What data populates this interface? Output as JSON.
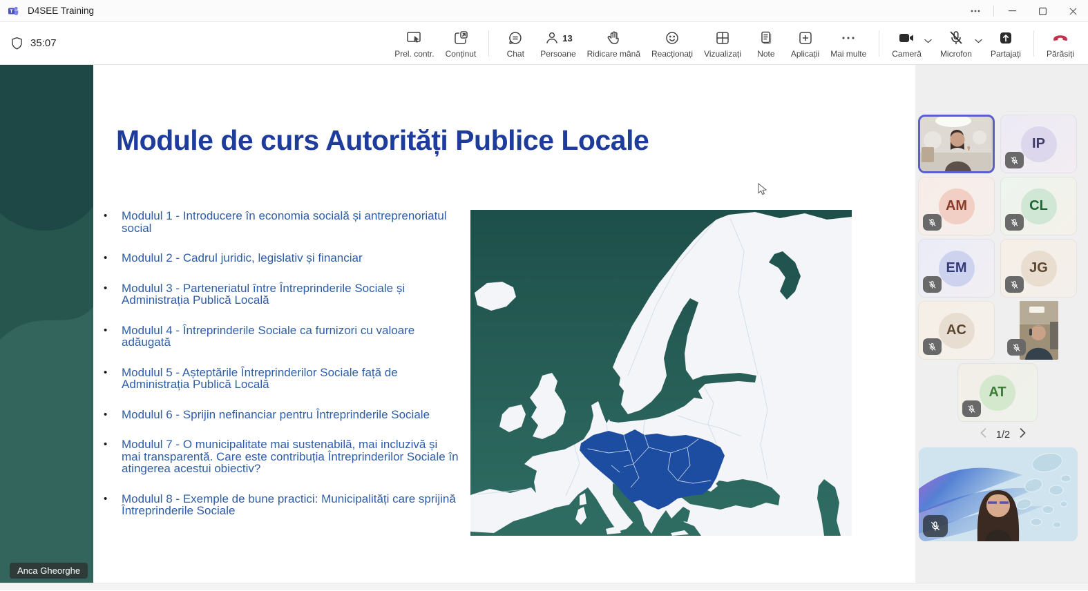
{
  "window": {
    "title": "D4SEE Training"
  },
  "meeting": {
    "timer": "35:07"
  },
  "toolbar": {
    "items": [
      {
        "id": "prel-contr",
        "label": "Prel. contr."
      },
      {
        "id": "continut",
        "label": "Conținut"
      },
      {
        "id": "chat",
        "label": "Chat"
      },
      {
        "id": "persoane",
        "label": "Persoane",
        "count": "13"
      },
      {
        "id": "ridicare-mana",
        "label": "Ridicare mână"
      },
      {
        "id": "reactionati",
        "label": "Reacționați"
      },
      {
        "id": "vizualizati",
        "label": "Vizualizați"
      },
      {
        "id": "note",
        "label": "Note"
      },
      {
        "id": "aplicatii",
        "label": "Aplicații"
      },
      {
        "id": "mai-multe",
        "label": "Mai multe"
      },
      {
        "id": "camera",
        "label": "Cameră"
      },
      {
        "id": "microfon",
        "label": "Microfon"
      },
      {
        "id": "partajati",
        "label": "Partajați"
      },
      {
        "id": "parasiti",
        "label": "Părăsiți"
      }
    ]
  },
  "slide": {
    "title": "Module de curs Autorități Publice Locale",
    "bullets": [
      "Modulul 1 - Introducere în economia socială și antreprenoriatul social",
      "Modulul 2 - Cadrul juridic, legislativ și financiar",
      "Modulul 3 - Parteneriatul între Întreprinderile Sociale și Administrația Publică Locală",
      "Modulul 4 - Întreprinderile Sociale ca furnizori cu valoare adăugată",
      "Modulul 5 - Așteptările Întreprinderilor Sociale față de Administrația Publică Locală",
      "Modulul 6 - Sprijin nefinanciar pentru Întreprinderile Sociale",
      "Modulul 7 - O municipalitate mai sustenabilă, mai incluzivă și mai transparentă. Care este contribuția Întreprinderilor Sociale în atingerea acestui obiectiv?",
      "Modulul 8 - Exemple de bune practici: Municipalități care sprijină Întreprinderile Sociale"
    ]
  },
  "share": {
    "presenter_name": "Anca Gheorghe"
  },
  "participants": {
    "pagination": "1/2",
    "tiles": [
      {
        "initials": "IP",
        "muted": true
      },
      {
        "initials": "AM",
        "muted": true
      },
      {
        "initials": "CL",
        "muted": true
      },
      {
        "initials": "EM",
        "muted": true
      },
      {
        "initials": "JG",
        "muted": true
      },
      {
        "initials": "AC",
        "muted": true
      },
      {
        "initials": "AT",
        "muted": true
      }
    ]
  },
  "colors": {
    "accent": "#5b5fc7",
    "leave_red": "#c4314b",
    "slide_title": "#1e3c9c",
    "slide_text": "#2d5da8",
    "sidebar_teal": "#27554e",
    "map_sea": "#24574f",
    "map_land": "#f4f6f9",
    "map_highlight": "#1c4da1",
    "panel_bg": "#efefef"
  }
}
